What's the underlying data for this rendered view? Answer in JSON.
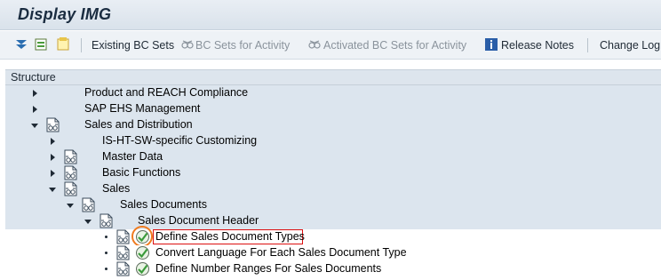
{
  "window": {
    "title": "Display IMG"
  },
  "toolbar": {
    "existing_bc_sets": "Existing BC Sets",
    "bc_sets_for_activity": "BC Sets for Activity",
    "activated_bc_sets_for_activity": "Activated BC Sets for Activity",
    "release_notes": "Release Notes",
    "change_log": "Change Log"
  },
  "tree": {
    "header": "Structure",
    "rows": [
      {
        "label": "Product and REACH Compliance",
        "state": "collapsed",
        "icon": "none"
      },
      {
        "label": "SAP EHS Management",
        "state": "collapsed",
        "icon": "none"
      },
      {
        "label": "Sales and Distribution",
        "state": "expanded",
        "icon": "document-glasses-icon"
      },
      {
        "label": "IS-HT-SW-specific Customizing",
        "state": "collapsed",
        "icon": "none"
      },
      {
        "label": "Master Data",
        "state": "collapsed",
        "icon": "document-glasses-icon"
      },
      {
        "label": "Basic Functions",
        "state": "collapsed",
        "icon": "document-glasses-icon"
      },
      {
        "label": "Sales",
        "state": "expanded",
        "icon": "document-glasses-icon"
      },
      {
        "label": "Sales Documents",
        "state": "expanded",
        "icon": "document-glasses-icon"
      },
      {
        "label": "Sales Document Header",
        "state": "expanded",
        "icon": "document-glasses-icon"
      },
      {
        "label": "Define Sales Document Types",
        "state": "leaf",
        "icon": "execute-clock-icon",
        "selected": true
      },
      {
        "label": "Convert Language For Each Sales Document Type",
        "state": "leaf",
        "icon": "execute-clock-icon"
      },
      {
        "label": "Define Number Ranges For Sales Documents",
        "state": "leaf",
        "icon": "execute-clock-icon"
      }
    ]
  },
  "colors": {
    "row_blue": "#dce5ee",
    "highlight_red": "#dd1111",
    "ring_orange": "#f07b1f",
    "exec_green": "#3a9a3a"
  }
}
